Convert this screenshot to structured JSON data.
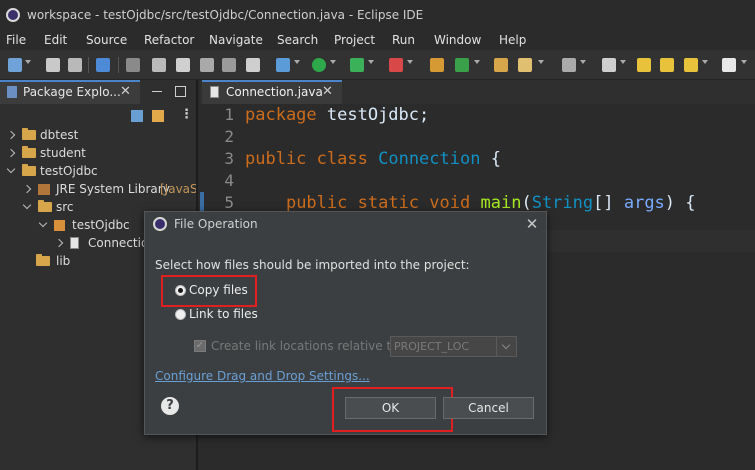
{
  "window": {
    "title": "workspace - testOjdbc/src/testOjdbc/Connection.java - Eclipse IDE"
  },
  "menu": [
    "File",
    "Edit",
    "Source",
    "Refactor",
    "Navigate",
    "Search",
    "Project",
    "Run",
    "Window",
    "Help"
  ],
  "package_explorer": {
    "tab_label": "Package Explo...",
    "tree": [
      {
        "label": "dbtest",
        "level": 0,
        "expanded": false
      },
      {
        "label": "student",
        "level": 0,
        "expanded": false
      },
      {
        "label": "testOjdbc",
        "level": 0,
        "expanded": true
      },
      {
        "label": "JRE System Library",
        "suffix": "[JavaS",
        "level": 1,
        "expanded": false
      },
      {
        "label": "src",
        "level": 1,
        "expanded": true
      },
      {
        "label": "testOjdbc",
        "level": 2,
        "expanded": true
      },
      {
        "label": "Connection",
        "level": 3,
        "expanded": false
      },
      {
        "label": "lib",
        "level": 1,
        "expanded": false
      }
    ]
  },
  "editor": {
    "tab_label": "Connection.java",
    "lines": [
      {
        "num": "1",
        "tokens": [
          [
            "kw",
            "package"
          ],
          [
            "plain",
            " testOjdbc;"
          ]
        ]
      },
      {
        "num": "2",
        "tokens": []
      },
      {
        "num": "3",
        "tokens": [
          [
            "kw",
            "public"
          ],
          [
            "plain",
            " "
          ],
          [
            "kw",
            "class"
          ],
          [
            "plain",
            " "
          ],
          [
            "cls",
            "Connection"
          ],
          [
            "plain",
            " {"
          ]
        ]
      },
      {
        "num": "4",
        "tokens": []
      },
      {
        "num": "5",
        "tokens": [
          [
            "plain",
            "    "
          ],
          [
            "kw",
            "public"
          ],
          [
            "plain",
            " "
          ],
          [
            "kw",
            "static"
          ],
          [
            "plain",
            " "
          ],
          [
            "kw",
            "void"
          ],
          [
            "plain",
            " "
          ],
          [
            "fn",
            "main"
          ],
          [
            "plain",
            "("
          ],
          [
            "cls",
            "String"
          ],
          [
            "plain",
            "[] "
          ],
          [
            "param",
            "args"
          ],
          [
            "plain",
            ") {"
          ]
        ]
      }
    ]
  },
  "dialog": {
    "title": "File Operation",
    "close_label": "✕",
    "prompt": "Select how files should be imported into the project:",
    "option_copy": "Copy files",
    "option_link": "Link to files",
    "option_selected": "copy",
    "checkbox_label": "Create link locations relative to:",
    "select_value": "PROJECT_LOC",
    "link_settings": "Configure Drag and Drop Settings...",
    "help_label": "?",
    "ok_label": "OK",
    "cancel_label": "Cancel"
  },
  "colors": {
    "highlight_box": "#e02020",
    "link": "#6a9fd4",
    "keyword": "#cc6c1d",
    "class_name": "#1290c3"
  }
}
